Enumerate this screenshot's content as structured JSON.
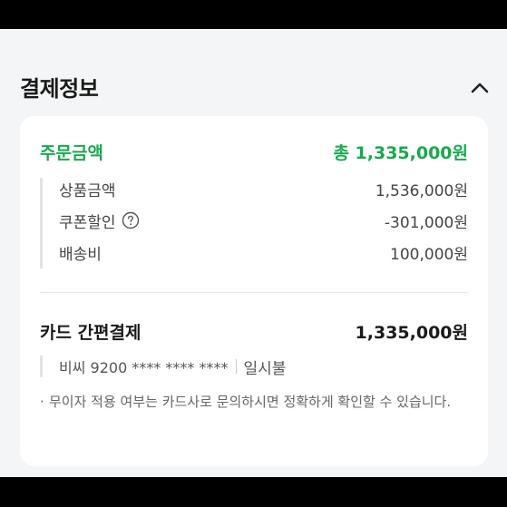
{
  "section": {
    "title": "결제정보",
    "collapse_icon": "chevron-up-icon"
  },
  "order": {
    "label": "주문금액",
    "total": "총 1,335,000원",
    "accent_color": "#1aa84f",
    "details": [
      {
        "label": "상품금액",
        "amount": "1,536,000원"
      },
      {
        "label": "쿠폰할인",
        "amount": "-301,000원",
        "has_help": true,
        "help_icon": "question-circle-icon"
      },
      {
        "label": "배송비",
        "amount": "100,000원"
      }
    ]
  },
  "payment": {
    "method_label": "카드 간편결제",
    "amount": "1,335,000원",
    "card": "비씨 9200 **** **** ****",
    "installment": "일시불",
    "notice": "무이자 적용 여부는 카드사로 문의하시면 정확하게 확인할 수 있습니다."
  }
}
